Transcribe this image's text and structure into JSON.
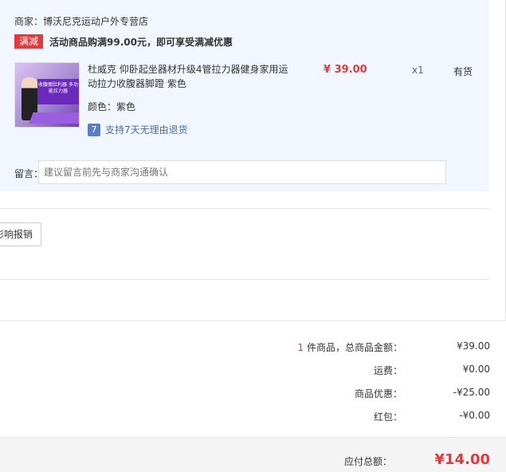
{
  "store": {
    "name": "商家：博沃尼克运动户外专营店",
    "promo_tag": "满减",
    "promo_text": "活动商品购满99.00元，即可享受满减优惠"
  },
  "item": {
    "title": "杜威克 仰卧起坐器材升级4管拉力器健身家用运动拉力收腹器脚蹬 紫色",
    "thumb_banner": "收腹瘦肚利器 多功能拉力器",
    "color": "颜色：紫色",
    "return_icon": "7",
    "return_text": "支持7天无理由退货",
    "price": "¥ 39.00",
    "qty": "x1",
    "stock": "有货"
  },
  "remark": {
    "label": "留言：",
    "placeholder": "建议留言前先与商家沟通确认"
  },
  "receipt_button": "影响报销",
  "summary": {
    "count": "1",
    "count_label": " 件商品，总商品金额：",
    "goods_amount": "¥39.00",
    "shipping_label": "运费：",
    "shipping": "¥0.00",
    "discount_label": "商品优惠：",
    "discount": "-¥25.00",
    "redpacket_label": "红包：",
    "redpacket": "-¥0.00"
  },
  "total": {
    "label": "应付总额：",
    "value": "¥14.00"
  },
  "colors": {
    "accent": "#e4393c",
    "store_bg": "#f2f7ff",
    "link": "#4a6da7"
  }
}
